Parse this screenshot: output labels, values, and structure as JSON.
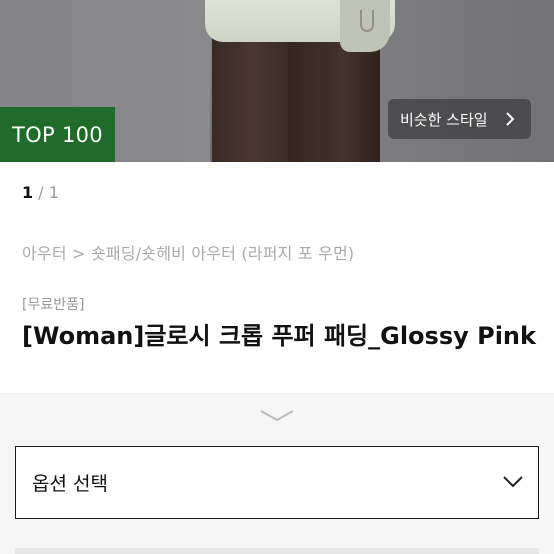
{
  "hero": {
    "badge": "TOP 100",
    "similar_style_label": "비슷한 스타일"
  },
  "pager": {
    "current": "1",
    "separator": " / ",
    "total": "1"
  },
  "breadcrumb": "아우터 > 숏패딩/숏헤비 아우터 (라퍼지 포 우먼)",
  "product": {
    "tag": "[무료반품]",
    "title": "[Woman]글로시 크롭 푸퍼 패딩_Glossy Pink"
  },
  "options": {
    "select_label": "옵션 선택"
  },
  "colors": {
    "badge_green": "#1f6b2a",
    "sheet_bg": "#f6f6f6"
  },
  "icons": {
    "similar_chevron": "chevron-right-icon",
    "sheet_handle": "chevron-down-icon",
    "select_chevron": "chevron-down-icon"
  }
}
